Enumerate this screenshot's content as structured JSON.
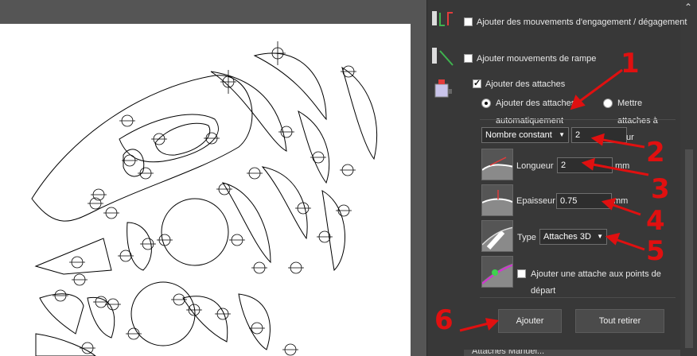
{
  "panel": {
    "engage_label": "Ajouter des mouvements d'engagement / dégagement",
    "ramp_label": "Ajouter mouvements de rampe",
    "tabs_label": "Ajouter des attaches",
    "auto_radio_label": "Ajouter des attaches",
    "auto_radio_label2": "automatiquement",
    "manual_radio_label": "Mettre",
    "manual_radio_label2": "attaches à",
    "manual_radio_label3": "ur",
    "count_mode": "Nombre constant",
    "count_value": "2",
    "length_label": "Longueur",
    "length_value": "2",
    "length_unit": "mm",
    "thickness_label": "Epaisseur",
    "thickness_value": "0.75",
    "thickness_unit": "mm",
    "type_label": "Type",
    "type_value": "Attaches 3D",
    "start_tab_label": "Ajouter une attache aux points de",
    "start_tab_label2": "départ",
    "add_button": "Ajouter",
    "remove_button": "Tout retirer",
    "bottom_partial": "Attaches Manuel..."
  },
  "annotations": [
    "1",
    "2",
    "3",
    "4",
    "5",
    "6"
  ],
  "icons": [
    "lead-in-out-icon",
    "ramp-icon",
    "tabs-icon",
    "length-thumb-icon",
    "thickness-thumb-icon",
    "type-thumb-icon",
    "start-point-thumb-icon",
    "collapse-chevron-icon"
  ],
  "colors": {
    "annotation": "#e01010",
    "panel_bg": "#383838",
    "canvas_paper": "#ffffff"
  }
}
